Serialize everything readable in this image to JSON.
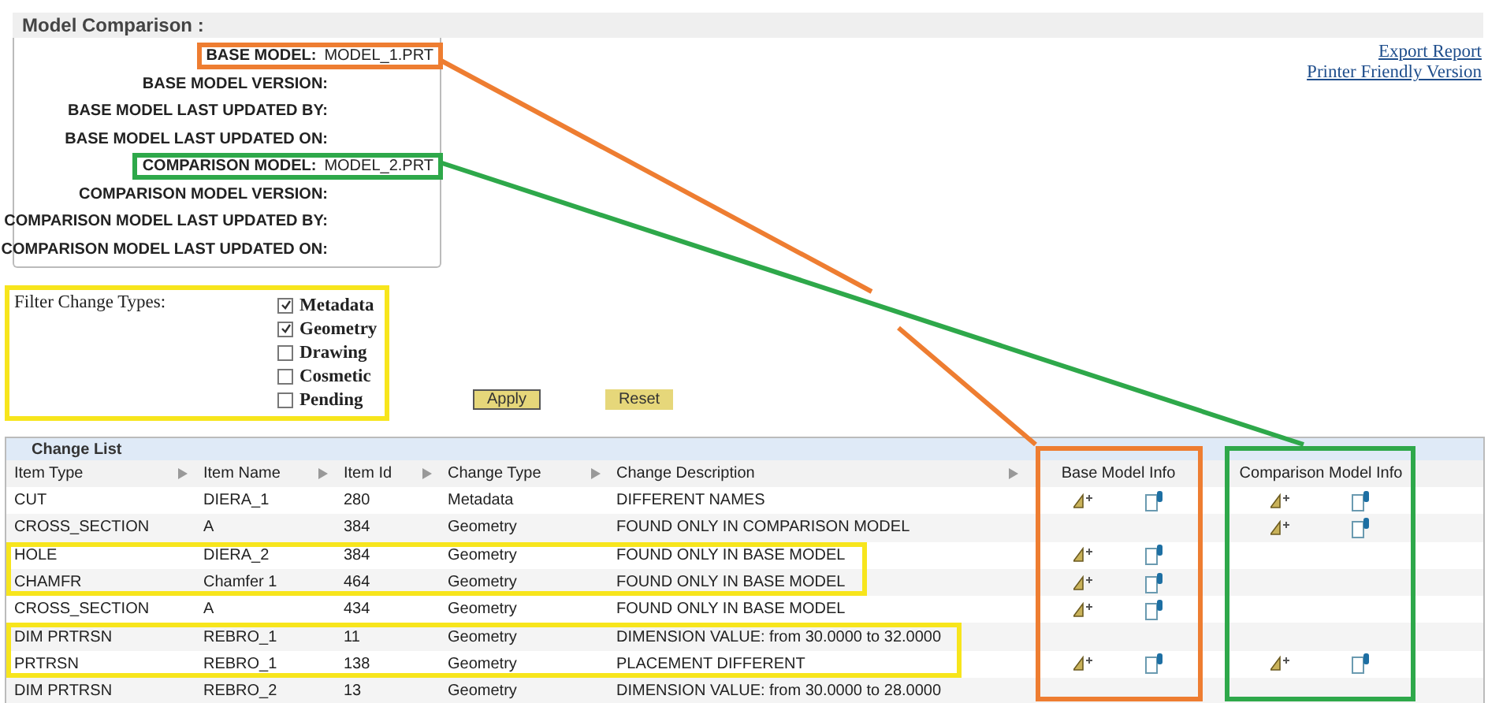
{
  "page_title": "Model Comparison :",
  "links": [
    "Export Report",
    "Printer Friendly Version"
  ],
  "model_fields": [
    {
      "label": "BASE MODEL:",
      "value": "MODEL_1.PRT",
      "color": "#ee7d31"
    },
    {
      "label": "BASE MODEL VERSION:"
    },
    {
      "label": "BASE MODEL LAST UPDATED BY:"
    },
    {
      "label": "BASE MODEL LAST UPDATED ON:"
    },
    {
      "label": "COMPARISON MODEL:",
      "value": "MODEL_2.PRT",
      "color": "#2ea84a"
    },
    {
      "label": "COMPARISON MODEL VERSION:"
    },
    {
      "label": "COMPARISON MODEL LAST UPDATED BY:"
    },
    {
      "label": "COMPARISON MODEL LAST UPDATED ON:"
    }
  ],
  "filter": {
    "title": "Filter Change Types:",
    "color": "#f7e51c",
    "options": [
      {
        "label": "Metadata",
        "checked": true
      },
      {
        "label": "Geometry",
        "checked": true
      },
      {
        "label": "Drawing",
        "checked": false
      },
      {
        "label": "Cosmetic",
        "checked": false
      },
      {
        "label": "Pending",
        "checked": false
      }
    ]
  },
  "buttons": [
    {
      "label": "Apply",
      "selected": true
    },
    {
      "label": "Reset",
      "selected": false
    }
  ],
  "change_list": {
    "title": "Change List",
    "columns": [
      "Item Type",
      "Item Name",
      "Item Id",
      "Change Type",
      "Change Description"
    ],
    "info_columns": [
      {
        "label": "Base Model Info",
        "color": "#ee7d31"
      },
      {
        "label": "Comparison Model Info",
        "color": "#2ea84a"
      }
    ],
    "row_groups": [
      {
        "rows": [
          {
            "cells": [
              "CUT",
              "DIERA_1",
              "280",
              "Metadata",
              "DIFFERENT NAMES"
            ],
            "base_info": true,
            "comparison_info": true
          },
          {
            "cells": [
              "CROSS_SECTION",
              "A",
              "384",
              "Geometry",
              "FOUND ONLY IN COMPARISON MODEL"
            ],
            "base_info": false,
            "comparison_info": true
          }
        ]
      },
      {
        "color": "#f7e51c",
        "rows": [
          {
            "cells": [
              "HOLE",
              "DIERA_2",
              "384",
              "Geometry",
              "FOUND ONLY IN BASE MODEL"
            ],
            "base_info": true,
            "comparison_info": false
          },
          {
            "cells": [
              "CHAMFR",
              "Chamfer 1",
              "464",
              "Geometry",
              "FOUND ONLY IN BASE MODEL"
            ],
            "base_info": true,
            "comparison_info": false
          }
        ]
      },
      {
        "rows": [
          {
            "cells": [
              "CROSS_SECTION",
              "A",
              "434",
              "Geometry",
              "FOUND ONLY IN BASE MODEL"
            ],
            "base_info": true,
            "comparison_info": false
          }
        ]
      },
      {
        "color": "#f7e51c",
        "rows": [
          {
            "cells": [
              "DIM PRTRSN",
              "REBRO_1",
              "11",
              "Geometry",
              "DIMENSION VALUE: from 30.0000 to 32.0000"
            ],
            "base_info": false,
            "comparison_info": false
          },
          {
            "cells": [
              "PRTRSN",
              "REBRO_1",
              "138",
              "Geometry",
              "PLACEMENT DIFFERENT"
            ],
            "base_info": true,
            "comparison_info": true
          }
        ]
      },
      {
        "rows": [
          {
            "cells": [
              "DIM PRTRSN",
              "REBRO_2",
              "13",
              "Geometry",
              "DIMENSION VALUE: from 30.0000 to 28.0000"
            ],
            "base_info": false,
            "comparison_info": false
          }
        ]
      }
    ]
  }
}
